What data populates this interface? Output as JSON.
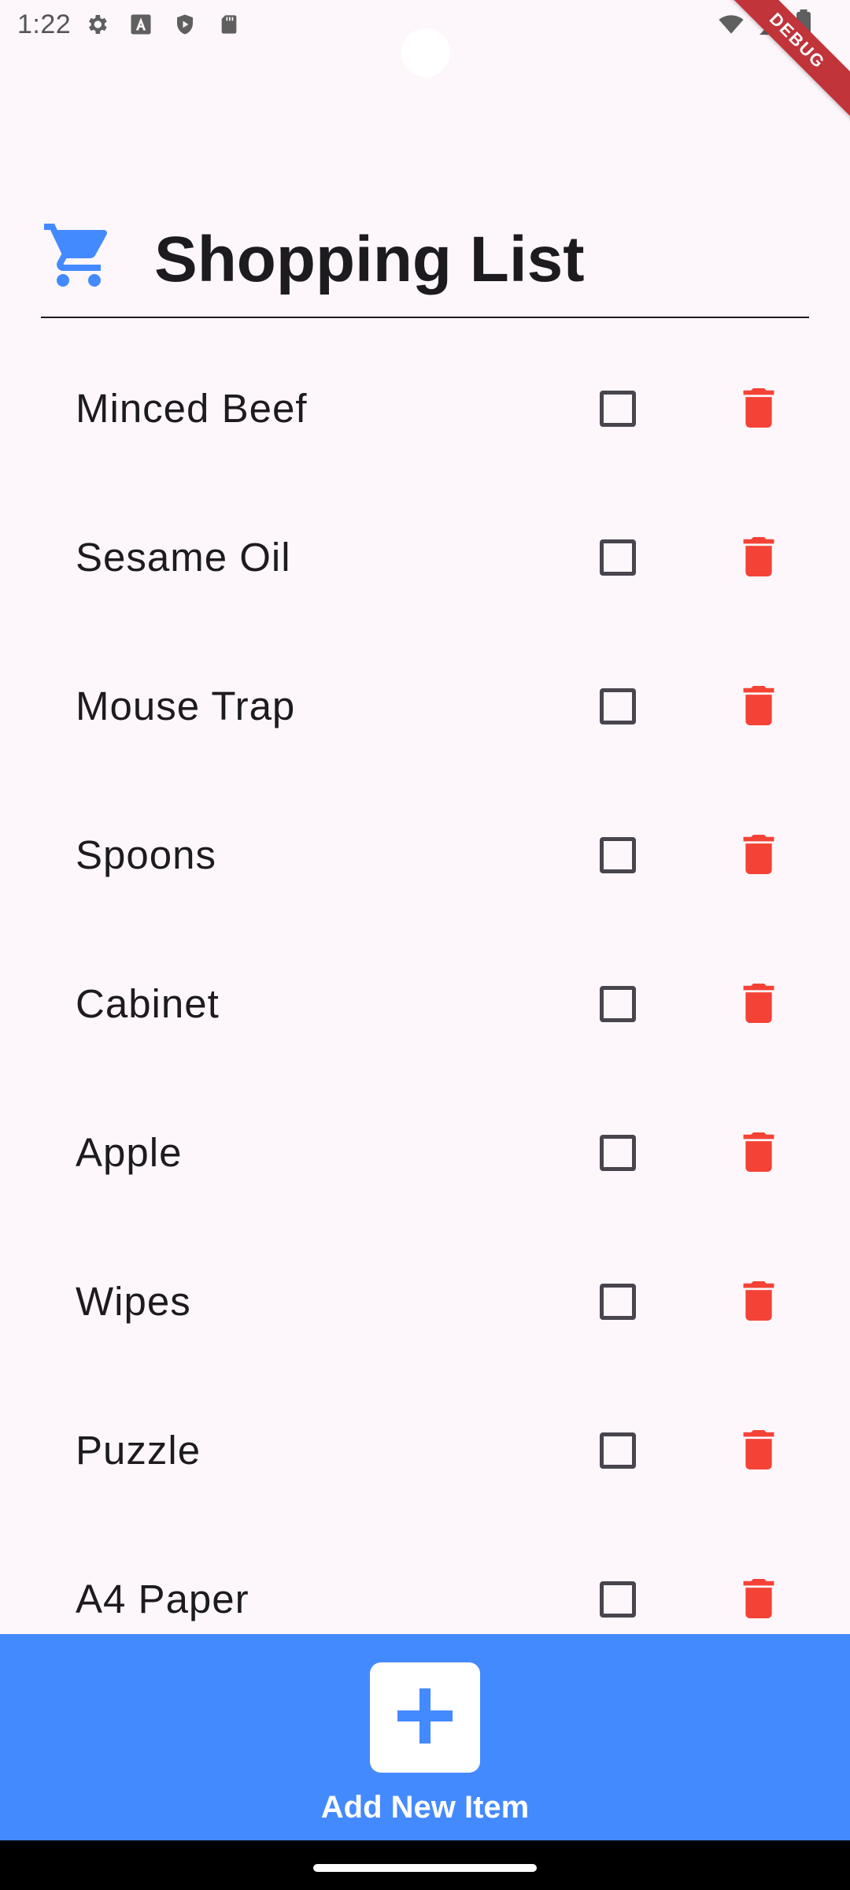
{
  "status_bar": {
    "time": "1:22",
    "left_icons": [
      "gear-icon",
      "font-a-icon",
      "shield-play-icon",
      "sd-card-icon"
    ],
    "right_icons": [
      "wifi-icon",
      "signal-icon",
      "battery-icon"
    ]
  },
  "debug_banner": "DEBUG",
  "header": {
    "icon": "shopping-cart-icon",
    "title": "Shopping List"
  },
  "items": [
    {
      "name": "Minced Beef",
      "checked": false
    },
    {
      "name": "Sesame Oil",
      "checked": false
    },
    {
      "name": "Mouse Trap",
      "checked": false
    },
    {
      "name": "Spoons",
      "checked": false
    },
    {
      "name": "Cabinet",
      "checked": false
    },
    {
      "name": "Apple",
      "checked": false
    },
    {
      "name": "Wipes",
      "checked": false
    },
    {
      "name": "Puzzle",
      "checked": false
    },
    {
      "name": "A4 Paper",
      "checked": false
    }
  ],
  "bottom_bar": {
    "add_label": "Add New Item"
  },
  "colors": {
    "background": "#fdf7fb",
    "accent": "#448aff",
    "delete": "#f44336",
    "text": "#1d1b20"
  }
}
